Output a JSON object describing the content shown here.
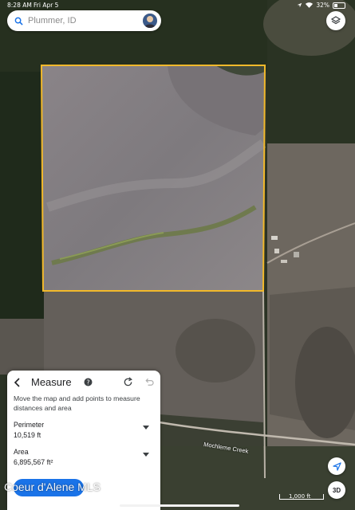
{
  "status_bar": {
    "time": "8:28 AM",
    "date": "Fri Apr 5",
    "battery": "32%",
    "battery_level": 0.32
  },
  "search": {
    "placeholder": "Plummer, ID"
  },
  "map": {
    "road_label": "Mochleme Creek",
    "scale_label": "1,000 ft",
    "boundary_color": "#f2b92b"
  },
  "panel": {
    "title": "Measure",
    "description": "Move the map and add points to measure distances and area",
    "perimeter_label": "Perimeter",
    "perimeter_value": "10,519 ft",
    "area_label": "Area",
    "area_value": "6,895,567 ft²"
  },
  "controls": {
    "three_d_label": "3D"
  },
  "watermark": "Coeur d'Alene MLS",
  "colors": {
    "accent": "#1a73e8"
  }
}
